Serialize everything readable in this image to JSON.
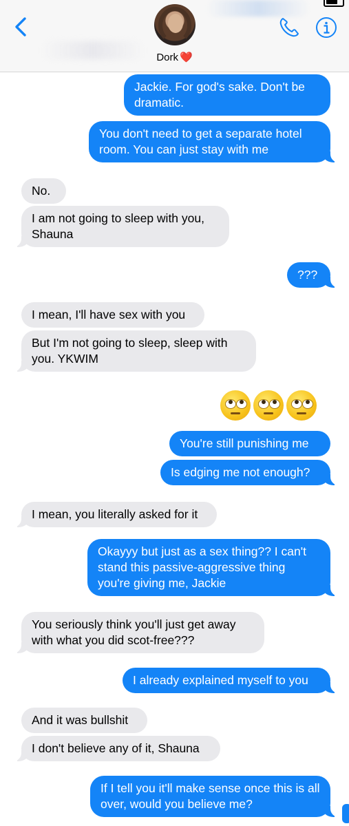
{
  "header": {
    "contact_name": "Dork",
    "contact_emoji": "❤️",
    "back_icon": "chevron-left-icon",
    "call_icon": "phone-icon",
    "info_icon": "info-icon",
    "accent_color": "#1484f7"
  },
  "messages": [
    {
      "from": "me",
      "text": "Jackie. For god's sake. Don't be dramatic."
    },
    {
      "from": "me",
      "text": "You don't need to get a separate hotel room. You can just stay with me"
    },
    {
      "from": "them",
      "text": "No."
    },
    {
      "from": "them",
      "text": "I am not going to sleep with you, Shauna"
    },
    {
      "from": "me",
      "text": "???"
    },
    {
      "from": "them",
      "text": "I mean, I'll have sex with you"
    },
    {
      "from": "them",
      "text": "But I'm not going to sleep, sleep with you. YKWIM"
    },
    {
      "from": "me",
      "type": "emoji",
      "text": "🙄🙄🙄"
    },
    {
      "from": "me",
      "text": "You're still punishing me"
    },
    {
      "from": "me",
      "text": "Is edging me not enough?"
    },
    {
      "from": "them",
      "text": "I mean, you literally asked for it"
    },
    {
      "from": "me",
      "text": "Okayyy but just as a sex thing?? I can't stand this passive-aggressive thing you're giving me, Jackie"
    },
    {
      "from": "them",
      "text": "You seriously think you'll just get away with what you did scot-free???"
    },
    {
      "from": "me",
      "text": "I already explained myself to you"
    },
    {
      "from": "them",
      "text": "And it was bullshit"
    },
    {
      "from": "them",
      "text": "I don't believe any of it, Shauna"
    },
    {
      "from": "me",
      "text": "If I tell you it'll make sense once this is all over, would you believe me?"
    }
  ]
}
